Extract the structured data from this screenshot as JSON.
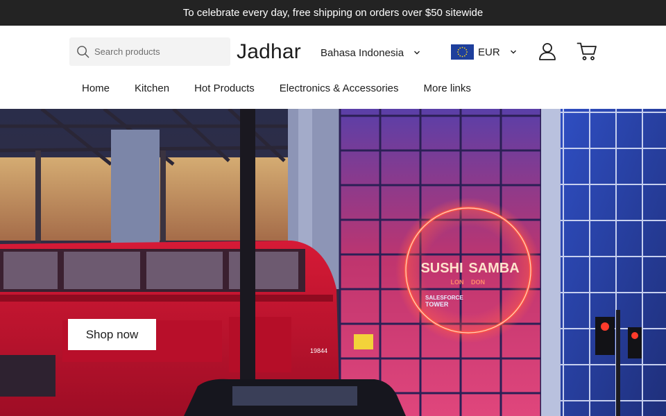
{
  "announcement": {
    "text": "To celebrate every day, free shipping on orders over $50 sitewide"
  },
  "header": {
    "search_placeholder": "Search products",
    "logo": "Jadhar",
    "language": "Bahasa Indonesia",
    "currency": "EUR",
    "currency_flag_icon": "eu-flag-icon",
    "account_icon": "user-icon",
    "cart_icon": "cart-icon"
  },
  "nav": {
    "items": [
      {
        "label": "Home"
      },
      {
        "label": "Kitchen"
      },
      {
        "label": "Hot Products"
      },
      {
        "label": "Electronics & Accessories"
      },
      {
        "label": "More links"
      }
    ]
  },
  "hero": {
    "cta_label": "Shop now",
    "sign_main_left": "SUSHI",
    "sign_main_right": "SAMBA",
    "sign_sub_left": "LON",
    "sign_sub_right": "DON",
    "sign_tower_1": "SALESFORCE",
    "sign_tower_2": "TOWER",
    "bus_number": "19844",
    "colors": {
      "bus_red": "#c8102e",
      "neon": "#ff4a3d",
      "glass_blue": "#3a4fb8"
    }
  }
}
